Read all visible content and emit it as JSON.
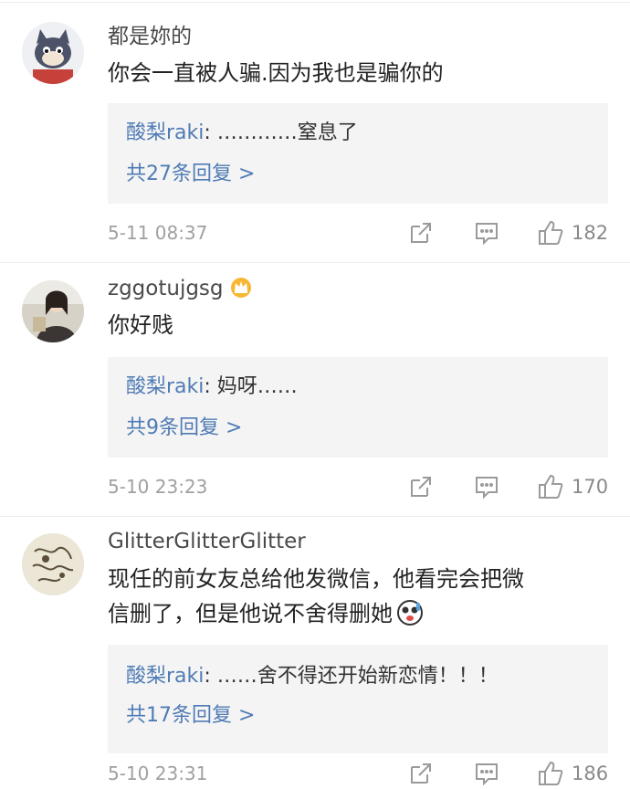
{
  "comments": [
    {
      "username": "都是妳的",
      "text": "你会一直被人骗.因为我也是骗你的",
      "reply": {
        "name": "酸梨raki",
        "sep": ": ",
        "text": "…………窒息了"
      },
      "reply_count": "共27条回复 >",
      "time": "5-11 08:37",
      "likes": "182",
      "avatar_icon": "cartoon-cat-avatar"
    },
    {
      "username": "zggotujgsg",
      "text": "你好贱",
      "reply": {
        "name": "酸梨raki",
        "sep": ": ",
        "text": "妈呀……"
      },
      "reply_count": "共9条回复 >",
      "time": "5-10 23:23",
      "likes": "170",
      "avatar_icon": "person-photo-avatar",
      "badge_icon": "crown-icon"
    },
    {
      "username": "GlitterGlitterGlitter",
      "text_line1": "现任的前女友总给他发微信，他看完会把微",
      "text_line2": "信删了，但是他说不舍得删她",
      "reply": {
        "name": "酸梨raki",
        "sep": ": ",
        "text": "……舍不得还开始新恋情！！！"
      },
      "reply_count": "共17条回复 >",
      "time": "5-10 23:31",
      "likes": "186",
      "avatar_icon": "sketch-drawing-avatar",
      "emoji_icon": "shocked-face-emoji"
    }
  ],
  "colors": {
    "link": "#4f7bb5",
    "reply_bg": "#f4f4f4",
    "meta": "#a0a0a0"
  }
}
